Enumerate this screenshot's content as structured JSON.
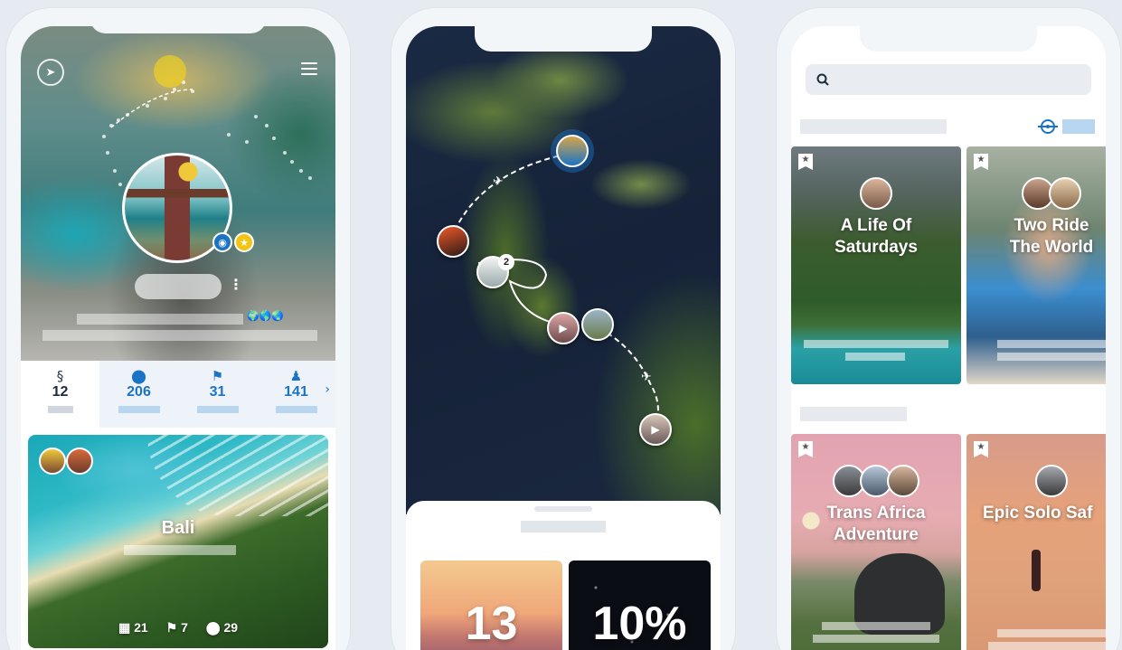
{
  "phone1": {
    "profile_stats": [
      {
        "icon": "route-icon",
        "value": "12"
      },
      {
        "icon": "pin-icon",
        "value": "206"
      },
      {
        "icon": "flag-icon",
        "value": "31"
      },
      {
        "icon": "people-icon",
        "value": "141"
      }
    ],
    "trip_card": {
      "title": "Bali",
      "days": "21",
      "countries": "7",
      "places": "29"
    }
  },
  "phone2": {
    "map_cluster_count": "2",
    "tiles": [
      {
        "value": "13"
      },
      {
        "value": "10%"
      }
    ]
  },
  "phone3": {
    "search": {
      "placeholder": "",
      "value": ""
    },
    "cards": [
      {
        "title": "A Life Of\nSaturdays"
      },
      {
        "title": "Two Ride\nThe World"
      },
      {
        "title": "Trans Africa\nAdventure"
      },
      {
        "title": "Epic Solo Saf"
      }
    ]
  },
  "colors": {
    "accent_blue": "#1b73c5",
    "stat_bar": "#b8d6f0",
    "background": "#e6ebf1"
  }
}
